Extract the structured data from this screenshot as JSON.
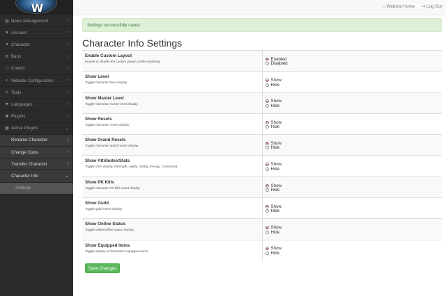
{
  "header": {
    "website_home": "Website Home",
    "log_out": "Log Out"
  },
  "sidebar": {
    "items": [
      {
        "label": "News Management",
        "icon": "newspaper-icon"
      },
      {
        "label": "Account",
        "icon": "users-icon"
      },
      {
        "label": "Character",
        "icon": "user-icon"
      },
      {
        "label": "Bans",
        "icon": "ban-icon"
      },
      {
        "label": "Credits",
        "icon": "credit-card-icon"
      },
      {
        "label": "Website Configuration",
        "icon": "toggle-icon"
      },
      {
        "label": "Tools",
        "icon": "wrench-icon"
      },
      {
        "label": "Languages",
        "icon": "flag-icon"
      },
      {
        "label": "Plugins",
        "icon": "puzzle-icon"
      },
      {
        "label": "Active Plugins",
        "icon": "box-icon"
      }
    ],
    "subitems": [
      {
        "label": "Rename Character"
      },
      {
        "label": "Change Class"
      },
      {
        "label": "Transfer Character"
      },
      {
        "label": "Character Info"
      }
    ],
    "active_sub": "Settings"
  },
  "alert": "Settings successfully saved.",
  "page_title": "Character Info Settings",
  "settings": [
    {
      "title": "Enable Custom Layout",
      "desc": "Enable or disable the custom player profile rendering.",
      "opt1": "Enabled",
      "opt2": "Disabled",
      "selected": 1
    },
    {
      "title": "Show Level",
      "desc": "Toggle character level display.",
      "opt1": "Show",
      "opt2": "Hide",
      "selected": 1
    },
    {
      "title": "Show Master Level",
      "desc": "Toggle character master level display.",
      "opt1": "Show",
      "opt2": "Hide",
      "selected": 1
    },
    {
      "title": "Show Resets",
      "desc": "Toggle character resets display.",
      "opt1": "Show",
      "opt2": "Hide",
      "selected": 1
    },
    {
      "title": "Show Grand Resets",
      "desc": "Toggle character grand resets display.",
      "opt1": "Show",
      "opt2": "Hide",
      "selected": 1
    },
    {
      "title": "Show Attributes/Stats",
      "desc": "Toggle stats display (Strength, Agility, Vitality, Energy, Command)",
      "opt1": "Show",
      "opt2": "Hide",
      "selected": 1
    },
    {
      "title": "Show PK Kills",
      "desc": "Toggle character PK kills count display.",
      "opt1": "Show",
      "opt2": "Hide",
      "selected": 1
    },
    {
      "title": "Show Guild",
      "desc": "Toggle guild name display.",
      "opt1": "Show",
      "opt2": "Hide",
      "selected": 1
    },
    {
      "title": "Show Online Status",
      "desc": "Toggle online/offline status display.",
      "opt1": "Show",
      "opt2": "Hide",
      "selected": 1
    },
    {
      "title": "Show Equipped Items",
      "desc": "Toggle display of character's equipped items.",
      "opt1": "Show",
      "opt2": "Hide",
      "selected": 1
    }
  ],
  "save_label": "Save Changes",
  "colors": {
    "sidebar_bg": "#2b2b2b",
    "alert_bg": "#dff0d8",
    "save_button": "#5cb85c"
  }
}
